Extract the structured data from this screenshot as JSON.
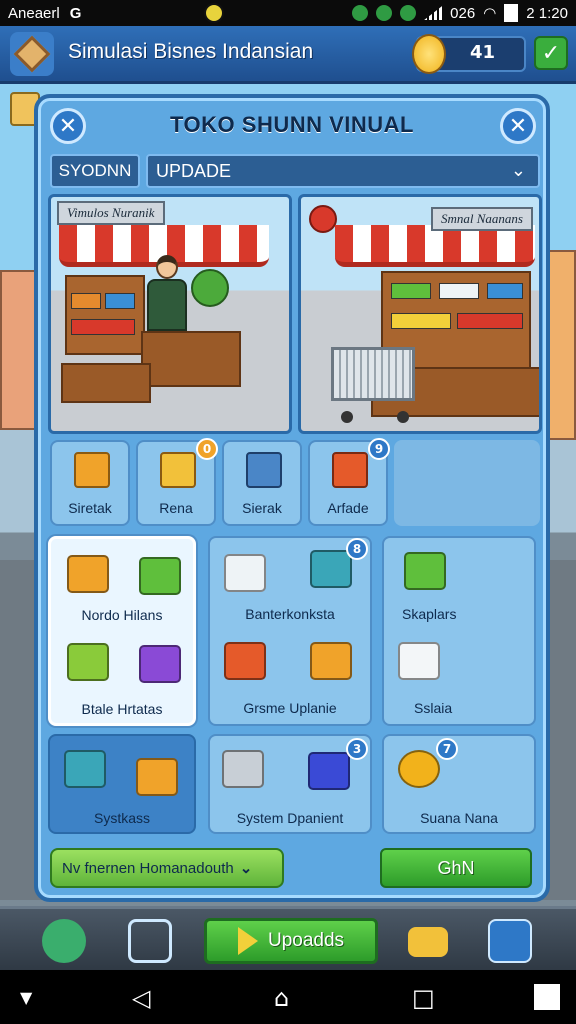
{
  "status_bar": {
    "carrier": "Aneaerl",
    "app_letter": "G",
    "battery": "026",
    "time": "2 1:20"
  },
  "header": {
    "title": "Simulasi Bisnes  Indansian",
    "coins": "41"
  },
  "panel": {
    "title": "TOKO SHUNN VINUAL",
    "dropdown_label": "SYODNN",
    "dropdown_value": "UPDADE",
    "scene_left_banner": "Vimulos Nuranik",
    "scene_right_banner": "Smnal Naanans"
  },
  "tabs": [
    {
      "label": "Siretak"
    },
    {
      "label": "Rena",
      "badge": "0"
    },
    {
      "label": "Sierak"
    },
    {
      "label": "Arfade",
      "badge": "9"
    }
  ],
  "grid": {
    "cell1_top": "Nordo Hilans",
    "cell1_bottom": "Btale Hrtatas",
    "cell2_top": "Banterkonksta",
    "cell2_bottom": "Grsme Uplanie",
    "cell2_badge": "8",
    "cell3_top": "Skaplars",
    "cell3_bottom": "Sslaia",
    "cell4": "Systkass",
    "cell5": "System Dpanient",
    "cell5_badge": "3",
    "cell6": "Suana Nana",
    "cell6_badge": "7"
  },
  "bottom": {
    "dropdown": "Nv fnernen Homanadouth",
    "button": "GhN"
  },
  "game_bar": {
    "upgrade_label": "Upoadds"
  },
  "colors": {
    "panel": "#5ea8e1",
    "accent_green": "#2d9c2a",
    "header_blue": "#1f4f8f"
  }
}
